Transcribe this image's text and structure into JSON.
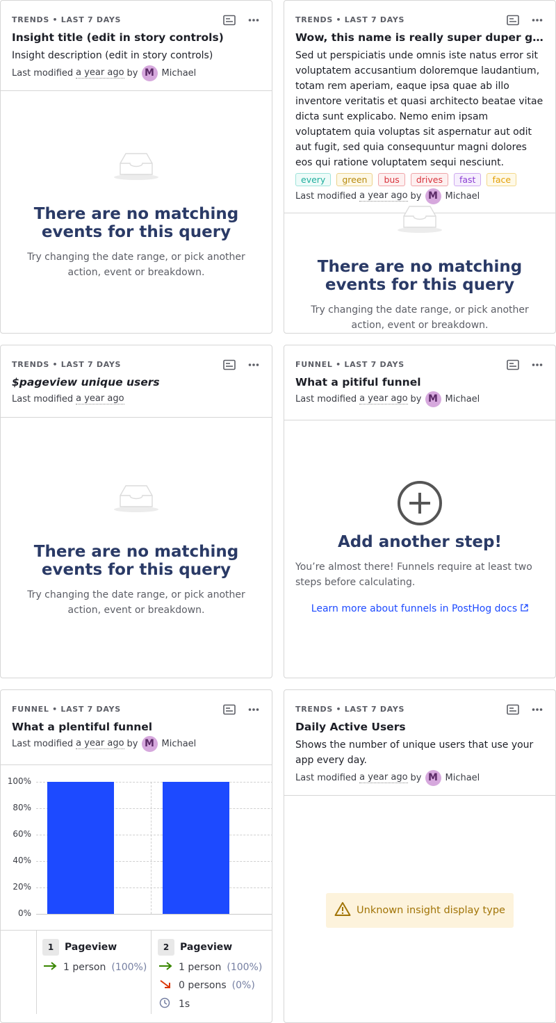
{
  "cards": [
    {
      "kicker": "TRENDS • LAST 7 DAYS",
      "title": "Insight title (edit in story controls)",
      "description": "Insight description (edit in story controls)",
      "meta_prefix": "Last modified",
      "meta_ago": "a year ago",
      "meta_by": "by",
      "avatar_letter": "M",
      "author": "Michael",
      "empty_title": "There are no matching events for this query",
      "empty_desc": "Try changing the date range, or pick another action, event or breakdown."
    },
    {
      "kicker": "TRENDS • LAST 7 DAYS",
      "title": "Wow, this name is really super duper ginor...",
      "description": "Sed ut perspiciatis unde omnis iste natus error sit voluptatem accusantium doloremque laudantium, totam rem aperiam, eaque ipsa quae ab illo inventore veritatis et quasi architecto beatae vitae dicta sunt explicabo. Nemo enim ipsam voluptatem quia voluptas sit aspernatur aut odit aut fugit, sed quia consequuntur magni dolores eos qui ratione voluptatem sequi nesciunt.",
      "tags": [
        "every",
        "green",
        "bus",
        "drives",
        "fast",
        "face"
      ],
      "meta_prefix": "Last modified",
      "meta_ago": "a year ago",
      "meta_by": "by",
      "avatar_letter": "M",
      "author": "Michael",
      "empty_title": "There are no matching events for this query",
      "empty_desc": "Try changing the date range, or pick another action, event or breakdown."
    },
    {
      "kicker": "TRENDS • LAST 7 DAYS",
      "title": "$pageview unique users",
      "meta_prefix": "Last modified",
      "meta_ago": "a year ago",
      "empty_title": "There are no matching events for this query",
      "empty_desc": "Try changing the date range, or pick another action, event or breakdown."
    },
    {
      "kicker": "FUNNEL • LAST 7 DAYS",
      "title": "What a pitiful funnel",
      "meta_prefix": "Last modified",
      "meta_ago": "a year ago",
      "meta_by": "by",
      "avatar_letter": "M",
      "author": "Michael",
      "add_title": "Add another step!",
      "add_desc": "You’re almost there! Funnels require at least two steps before calculating.",
      "add_link": "Learn more about funnels in PostHog docs"
    },
    {
      "kicker": "FUNNEL • LAST 7 DAYS",
      "title": "What a plentiful funnel",
      "meta_prefix": "Last modified",
      "meta_ago": "a year ago",
      "meta_by": "by",
      "avatar_letter": "M",
      "author": "Michael",
      "steps": [
        {
          "num": "1",
          "name": "Pageview",
          "conv_count": "1 person",
          "conv_pct": "(100%)"
        },
        {
          "num": "2",
          "name": "Pageview",
          "conv_count": "1 person",
          "conv_pct": "(100%)",
          "drop_count": "0 persons",
          "drop_pct": "(0%)",
          "time": "1s"
        }
      ]
    },
    {
      "kicker": "TRENDS • LAST 7 DAYS",
      "title": "Daily Active Users",
      "description": "Shows the number of unique users that use your app every day.",
      "meta_prefix": "Last modified",
      "meta_ago": "a year ago",
      "meta_by": "by",
      "avatar_letter": "M",
      "author": "Michael",
      "warning": "Unknown insight display type"
    }
  ],
  "tag_colors": {
    "every": "#1fae9d",
    "green": "#c99a10",
    "bus": "#d8333d",
    "drives": "#d8333d",
    "fast": "#8c3fd3",
    "face": "#e3a008"
  },
  "chart_data": {
    "type": "bar",
    "categories": [
      "Pageview",
      "Pageview"
    ],
    "values": [
      100,
      100
    ],
    "ylim": [
      0,
      100
    ],
    "yticks": [
      "100%",
      "80%",
      "60%",
      "40%",
      "20%",
      "0%"
    ],
    "grid": true,
    "color": "#1d4aff"
  }
}
